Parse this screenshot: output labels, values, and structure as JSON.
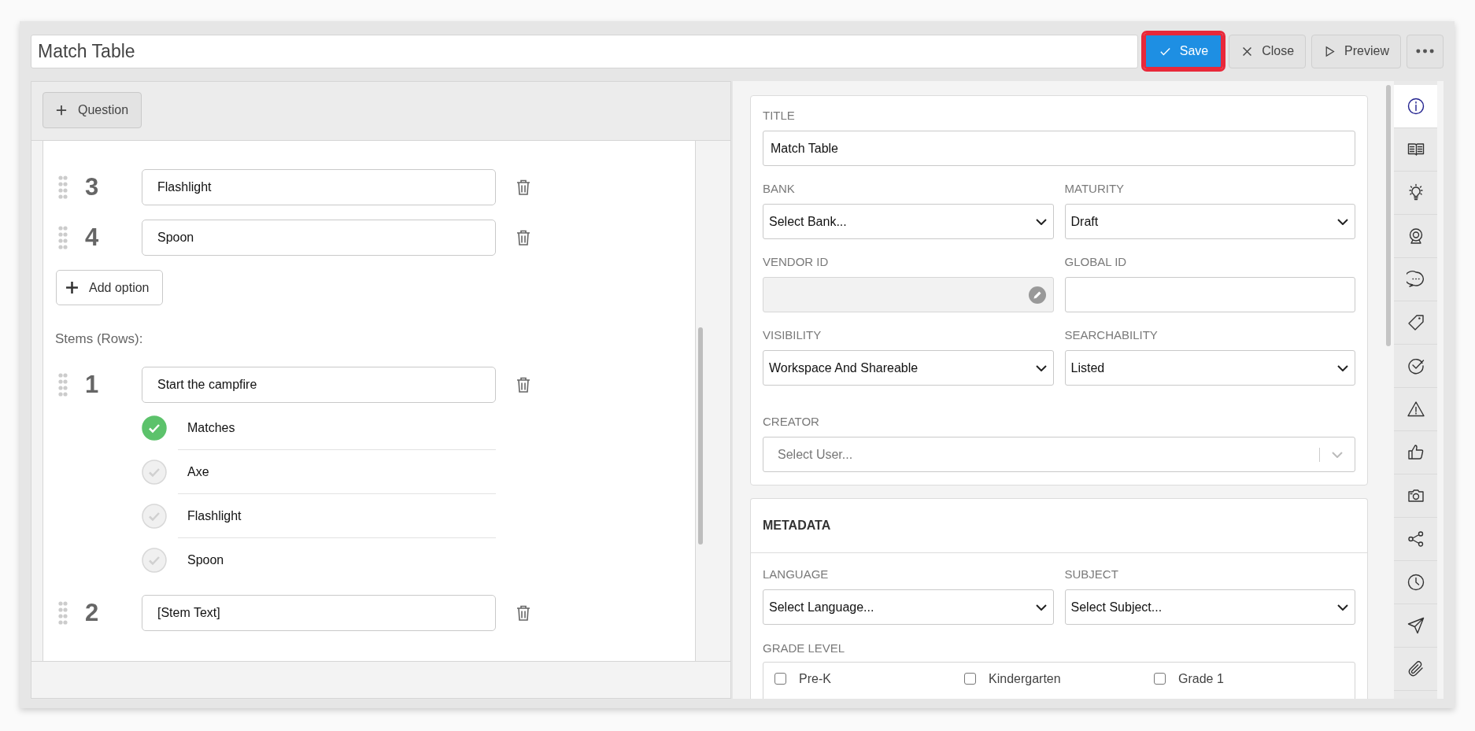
{
  "toolbar": {
    "title_value": "Match Table",
    "buttons": [
      {
        "kind": "save",
        "label": "Save",
        "highlighted": true
      },
      {
        "kind": "close",
        "label": "Close",
        "highlighted": false
      },
      {
        "kind": "preview",
        "label": "Preview",
        "highlighted": false
      },
      {
        "kind": "more",
        "highlighted": false
      }
    ]
  },
  "editor": {
    "add_question": "Question",
    "options": [
      {
        "number": "3",
        "value": "Flashlight"
      },
      {
        "number": "4",
        "value": "Spoon"
      }
    ],
    "add_option": "Add option",
    "stems_label": "Stems (Rows):",
    "stems": [
      {
        "number": "1",
        "value": "Start the campfire",
        "choices": [
          {
            "label": "Matches",
            "selected": true
          },
          {
            "label": "Axe",
            "selected": false
          },
          {
            "label": "Flashlight",
            "selected": false
          },
          {
            "label": "Spoon",
            "selected": false
          }
        ]
      },
      {
        "number": "2",
        "value": "[Stem Text]"
      }
    ]
  },
  "properties": {
    "rows": [
      [
        {
          "label": "TITLE",
          "kind": "text",
          "value": "Match Table",
          "disabled": false
        }
      ],
      [
        {
          "label": "BANK",
          "kind": "select",
          "value": "Select Bank..."
        },
        {
          "label": "MATURITY",
          "kind": "select",
          "value": "Draft"
        }
      ],
      [
        {
          "label": "VENDOR ID",
          "kind": "text",
          "disabled": true
        },
        {
          "label": "GLOBAL ID",
          "kind": "text",
          "disabled": false
        }
      ],
      [
        {
          "label": "VISIBILITY",
          "kind": "select",
          "value": "Workspace And Shareable"
        },
        {
          "label": "SEARCHABILITY",
          "kind": "select",
          "value": "Listed"
        }
      ],
      [
        {
          "label": "CREATOR",
          "kind": "combo",
          "placeholder": "Select User..."
        }
      ]
    ]
  },
  "metadata": {
    "title": "METADATA",
    "rows": [
      [
        {
          "label": "LANGUAGE",
          "kind": "select",
          "value": "Select Language..."
        },
        {
          "label": "SUBJECT",
          "kind": "select",
          "value": "Select Subject..."
        }
      ]
    ],
    "grade_level": {
      "label": "GRADE LEVEL",
      "options": [
        {
          "label": "Pre-K",
          "checked": false
        },
        {
          "label": "Kindergarten",
          "checked": false
        },
        {
          "label": "Grade 1",
          "checked": false
        }
      ]
    }
  },
  "sidebar": {
    "items": [
      {
        "kind": "info",
        "selected": true
      },
      {
        "kind": "book",
        "selected": false
      },
      {
        "kind": "bulb",
        "selected": false
      },
      {
        "kind": "webcam",
        "selected": false
      },
      {
        "kind": "chat",
        "selected": false
      },
      {
        "kind": "tag",
        "selected": false
      },
      {
        "kind": "check",
        "selected": false
      },
      {
        "kind": "warning",
        "selected": false
      },
      {
        "kind": "thumb",
        "selected": false
      },
      {
        "kind": "camera",
        "selected": false
      },
      {
        "kind": "share",
        "selected": false
      },
      {
        "kind": "clock",
        "selected": false
      },
      {
        "kind": "send",
        "selected": false
      },
      {
        "kind": "clip",
        "selected": false
      }
    ]
  }
}
